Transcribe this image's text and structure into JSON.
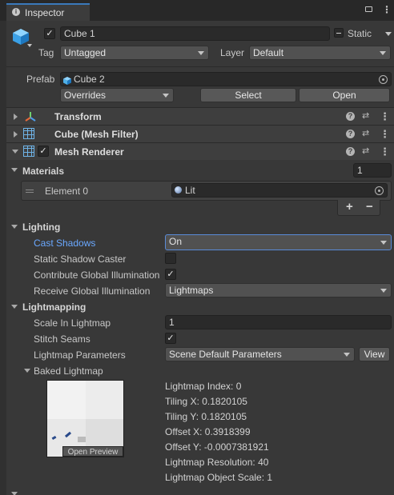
{
  "tab": {
    "title": "Inspector"
  },
  "object": {
    "name": "Cube 1",
    "static_label": "Static",
    "tag_label": "Tag",
    "tag_value": "Untagged",
    "layer_label": "Layer",
    "layer_value": "Default"
  },
  "prefab": {
    "label": "Prefab",
    "value": "Cube 2",
    "overrides": "Overrides",
    "select": "Select",
    "open": "Open"
  },
  "components": {
    "transform": "Transform",
    "mesh_filter": "Cube (Mesh Filter)",
    "mesh_renderer": "Mesh Renderer"
  },
  "materials": {
    "label": "Materials",
    "count": "1",
    "element_label": "Element 0",
    "element_value": "Lit",
    "add": "+",
    "remove": "−"
  },
  "lighting": {
    "label": "Lighting",
    "cast_shadows_label": "Cast Shadows",
    "cast_shadows_value": "On",
    "static_shadow_label": "Static Shadow Caster",
    "contribute_gi_label": "Contribute Global Illumination",
    "receive_gi_label": "Receive Global Illumination",
    "receive_gi_value": "Lightmaps"
  },
  "lightmapping": {
    "label": "Lightmapping",
    "scale_label": "Scale In Lightmap",
    "scale_value": "1",
    "stitch_label": "Stitch Seams",
    "params_label": "Lightmap Parameters",
    "params_value": "Scene Default Parameters",
    "view": "View",
    "baked_label": "Baked Lightmap",
    "open_preview": "Open Preview",
    "index": "Lightmap Index: 0",
    "tiling_x": "Tiling X: 0.1820105",
    "tiling_y": "Tiling Y: 0.1820105",
    "offset_x": "Offset X: 0.3918399",
    "offset_y": "Offset Y: -0.0007381921",
    "resolution": "Lightmap Resolution: 40",
    "object_scale": "Lightmap Object Scale: 1"
  },
  "colors": {
    "background": "#383838",
    "highlight_label": "#6aa8ff",
    "focus_border": "#5a8bd8",
    "prefab_icon": "#4fb0e8"
  }
}
